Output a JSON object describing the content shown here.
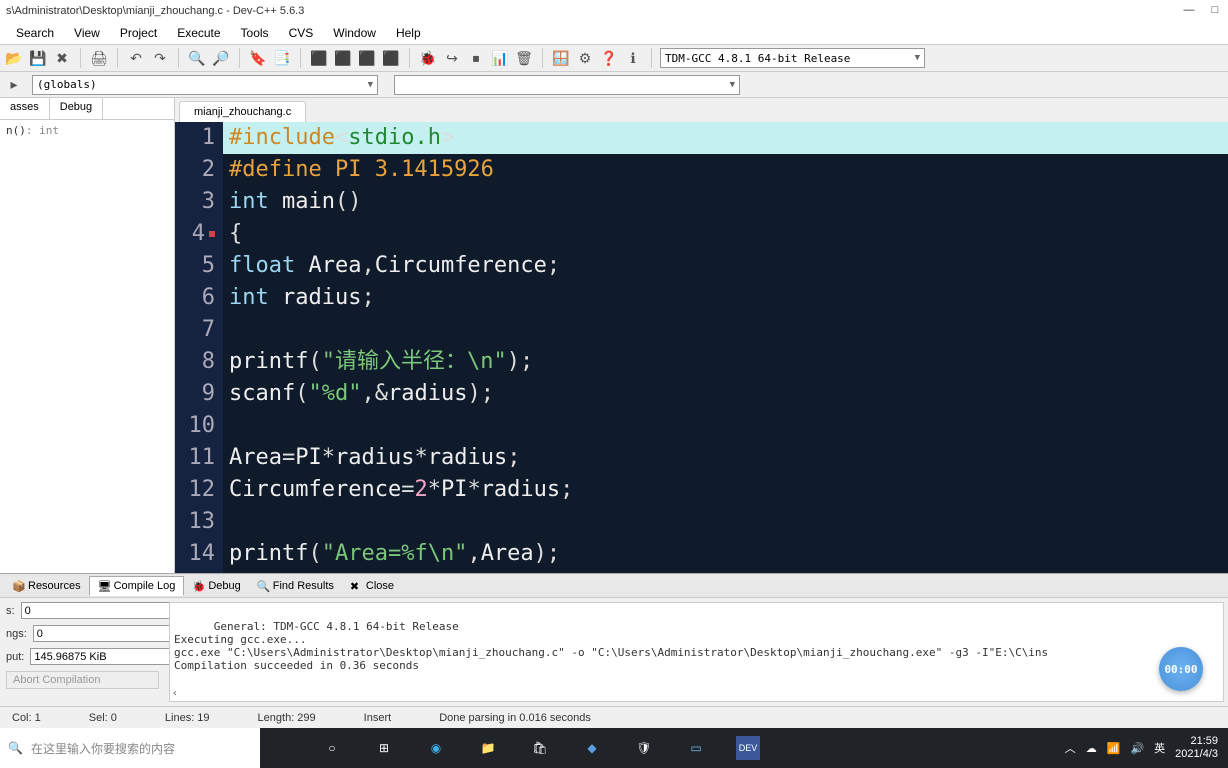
{
  "title": "s\\Administrator\\Desktop\\mianji_zhouchang.c - Dev-C++ 5.6.3",
  "menu": [
    "Search",
    "View",
    "Project",
    "Execute",
    "Tools",
    "CVS",
    "Window",
    "Help"
  ],
  "combos": {
    "globals": "(globals)",
    "secondary": "",
    "compiler": "TDM-GCC 4.8.1 64-bit Release"
  },
  "left_tabs": [
    "asses",
    "Debug"
  ],
  "left_tree": {
    "fn": "n()",
    "ret": ": int"
  },
  "file_tab": "mianji_zhouchang.c",
  "code": {
    "lines": [
      {
        "n": 1,
        "hl": true,
        "seg": [
          [
            "pre",
            "#include"
          ],
          [
            "pn",
            "<"
          ],
          [
            "str",
            "stdio.h"
          ],
          [
            "pn",
            ">"
          ]
        ]
      },
      {
        "n": 2,
        "seg": [
          [
            "pre",
            "#define PI 3.1415926"
          ]
        ]
      },
      {
        "n": 3,
        "seg": [
          [
            "kw",
            "int "
          ],
          [
            "fn",
            "main"
          ],
          [
            "pn",
            "()"
          ]
        ]
      },
      {
        "n": 4,
        "mark": true,
        "seg": [
          [
            "pn",
            "{"
          ]
        ]
      },
      {
        "n": 5,
        "seg": [
          [
            "kw",
            "float "
          ],
          [
            "id",
            "Area"
          ],
          [
            "pn",
            ","
          ],
          [
            "id",
            "Circumference"
          ],
          [
            "pn",
            ";"
          ]
        ]
      },
      {
        "n": 6,
        "seg": [
          [
            "kw",
            "int "
          ],
          [
            "id",
            "radius"
          ],
          [
            "pn",
            ";"
          ]
        ]
      },
      {
        "n": 7,
        "seg": []
      },
      {
        "n": 8,
        "seg": [
          [
            "fn",
            "printf"
          ],
          [
            "pn",
            "("
          ],
          [
            "str",
            "\"请输入半径：\\n\""
          ],
          [
            "pn",
            ");"
          ]
        ]
      },
      {
        "n": 9,
        "seg": [
          [
            "fn",
            "scanf"
          ],
          [
            "pn",
            "("
          ],
          [
            "str",
            "\"%d\""
          ],
          [
            "pn",
            ",&"
          ],
          [
            "id",
            "radius"
          ],
          [
            "pn",
            ");"
          ]
        ]
      },
      {
        "n": 10,
        "seg": []
      },
      {
        "n": 11,
        "seg": [
          [
            "id",
            "Area"
          ],
          [
            "pn",
            "="
          ],
          [
            "id",
            "PI"
          ],
          [
            "pn",
            "*"
          ],
          [
            "id",
            "radius"
          ],
          [
            "pn",
            "*"
          ],
          [
            "id",
            "radius"
          ],
          [
            "pn",
            ";"
          ]
        ]
      },
      {
        "n": 12,
        "seg": [
          [
            "id",
            "Circumference"
          ],
          [
            "pn",
            "="
          ],
          [
            "num",
            "2"
          ],
          [
            "pn",
            "*"
          ],
          [
            "id",
            "PI"
          ],
          [
            "pn",
            "*"
          ],
          [
            "id",
            "radius"
          ],
          [
            "pn",
            ";"
          ]
        ]
      },
      {
        "n": 13,
        "seg": []
      },
      {
        "n": 14,
        "seg": [
          [
            "fn",
            "printf"
          ],
          [
            "pn",
            "("
          ],
          [
            "str",
            "\"Area=%f\\n\""
          ],
          [
            "pn",
            ","
          ],
          [
            "id",
            "Area"
          ],
          [
            "pn",
            ");"
          ]
        ]
      }
    ]
  },
  "bottom_tabs": [
    "Resources",
    "Compile Log",
    "Debug",
    "Find Results",
    "Close"
  ],
  "bottom_active": 1,
  "stats": {
    "s_label": "s:",
    "s": "0",
    "ngs_label": "ngs:",
    "ngs": "0",
    "put_label": "put:",
    "put": "145.96875 KiB",
    "abort": "Abort Compilation"
  },
  "compile_log": "General: TDM-GCC 4.8.1 64-bit Release\nExecuting gcc.exe...\ngcc.exe \"C:\\Users\\Administrator\\Desktop\\mianji_zhouchang.c\" -o \"C:\\Users\\Administrator\\Desktop\\mianji_zhouchang.exe\" -g3 -I\"E:\\C\\ins\nCompilation succeeded in 0.36 seconds",
  "timer": "00:00",
  "status": {
    "col": "Col:   1",
    "sel": "Sel:    0",
    "lines": "Lines:   19",
    "length": "Length:   299",
    "mode": "Insert",
    "msg": "Done parsing in 0.016 seconds"
  },
  "taskbar": {
    "search_placeholder": "在这里输入你要搜索的内容",
    "ime": "英",
    "time": "21:59",
    "date": "2021/4/3"
  }
}
